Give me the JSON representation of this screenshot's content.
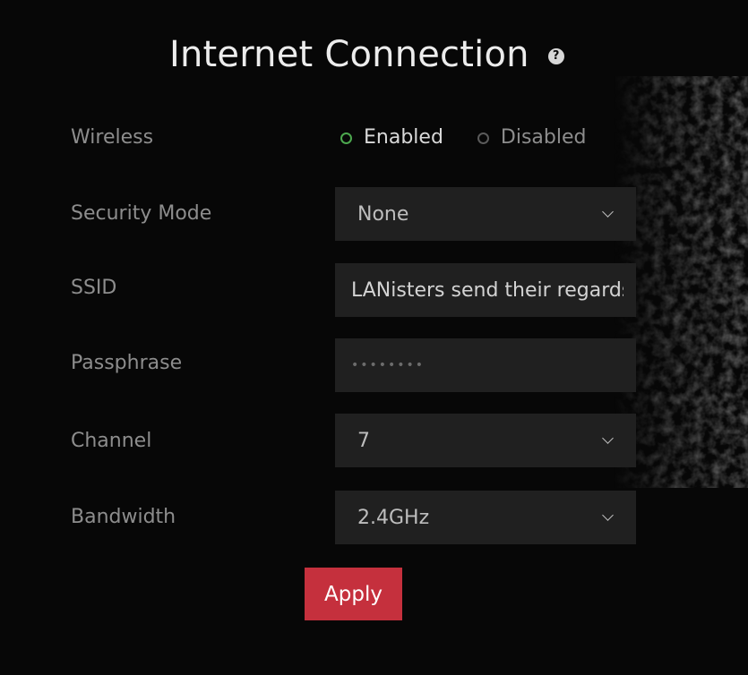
{
  "header": {
    "title": "Internet Connection",
    "help_glyph": "?"
  },
  "form": {
    "wireless": {
      "label": "Wireless",
      "options": [
        "Enabled",
        "Disabled"
      ],
      "selected": "Enabled"
    },
    "security_mode": {
      "label": "Security Mode",
      "value": "None"
    },
    "ssid": {
      "label": "SSID",
      "value": "LANisters send their regards"
    },
    "passphrase": {
      "label": "Passphrase",
      "value": "••••••••"
    },
    "channel": {
      "label": "Channel",
      "value": "7"
    },
    "bandwidth": {
      "label": "Bandwidth",
      "value": "2.4GHz"
    }
  },
  "actions": {
    "apply_label": "Apply"
  },
  "icons": {
    "help": "help-circle-icon",
    "dropdown": "chevron-down-icon",
    "radio": "radio-icon"
  },
  "colors": {
    "background": "#070707",
    "field_background": "#202020",
    "accent_selected": "#4ca84e",
    "apply_button": "#c5303d"
  }
}
